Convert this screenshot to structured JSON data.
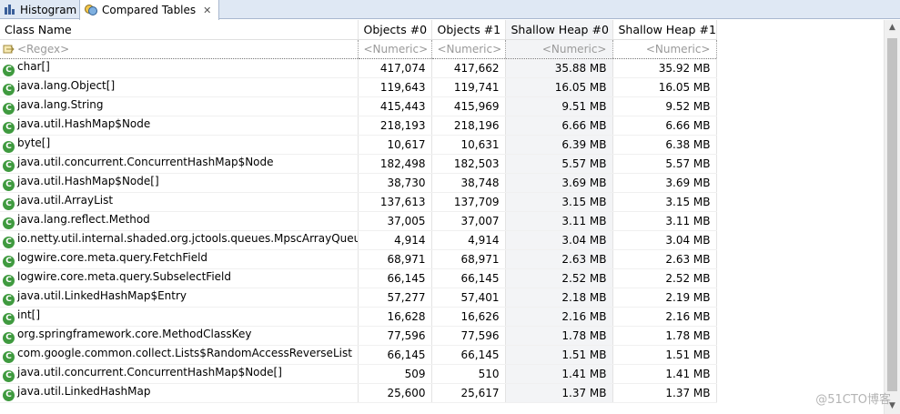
{
  "tabs": [
    {
      "label": "Histogram",
      "icon": "bar-chart-icon"
    },
    {
      "label": "Compared Tables",
      "icon": "compare-icon",
      "close": "✕"
    }
  ],
  "columns": [
    "Class Name",
    "Objects #0",
    "Objects #1",
    "Shallow Heap #0",
    "Shallow Heap #1"
  ],
  "filter": {
    "name": "<Regex>",
    "numeric": "<Numeric>"
  },
  "rows": [
    [
      "char[]",
      "417,074",
      "417,662",
      "35.88 MB",
      "35.92 MB"
    ],
    [
      "java.lang.Object[]",
      "119,643",
      "119,741",
      "16.05 MB",
      "16.05 MB"
    ],
    [
      "java.lang.String",
      "415,443",
      "415,969",
      "9.51 MB",
      "9.52 MB"
    ],
    [
      "java.util.HashMap$Node",
      "218,193",
      "218,196",
      "6.66 MB",
      "6.66 MB"
    ],
    [
      "byte[]",
      "10,617",
      "10,631",
      "6.39 MB",
      "6.38 MB"
    ],
    [
      "java.util.concurrent.ConcurrentHashMap$Node",
      "182,498",
      "182,503",
      "5.57 MB",
      "5.57 MB"
    ],
    [
      "java.util.HashMap$Node[]",
      "38,730",
      "38,748",
      "3.69 MB",
      "3.69 MB"
    ],
    [
      "java.util.ArrayList",
      "137,613",
      "137,709",
      "3.15 MB",
      "3.15 MB"
    ],
    [
      "java.lang.reflect.Method",
      "37,005",
      "37,007",
      "3.11 MB",
      "3.11 MB"
    ],
    [
      "io.netty.util.internal.shaded.org.jctools.queues.MpscArrayQueue",
      "4,914",
      "4,914",
      "3.04 MB",
      "3.04 MB"
    ],
    [
      "logwire.core.meta.query.FetchField",
      "68,971",
      "68,971",
      "2.63 MB",
      "2.63 MB"
    ],
    [
      "logwire.core.meta.query.SubselectField",
      "66,145",
      "66,145",
      "2.52 MB",
      "2.52 MB"
    ],
    [
      "java.util.LinkedHashMap$Entry",
      "57,277",
      "57,401",
      "2.18 MB",
      "2.19 MB"
    ],
    [
      "int[]",
      "16,628",
      "16,626",
      "2.16 MB",
      "2.16 MB"
    ],
    [
      "org.springframework.core.MethodClassKey",
      "77,596",
      "77,596",
      "1.78 MB",
      "1.78 MB"
    ],
    [
      "com.google.common.collect.Lists$RandomAccessReverseList",
      "66,145",
      "66,145",
      "1.51 MB",
      "1.51 MB"
    ],
    [
      "java.util.concurrent.ConcurrentHashMap$Node[]",
      "509",
      "510",
      "1.41 MB",
      "1.41 MB"
    ],
    [
      "java.util.LinkedHashMap",
      "25,600",
      "25,617",
      "1.37 MB",
      "1.37 MB"
    ]
  ],
  "class_icon_letter": "C",
  "watermark": "@51CTO博客"
}
